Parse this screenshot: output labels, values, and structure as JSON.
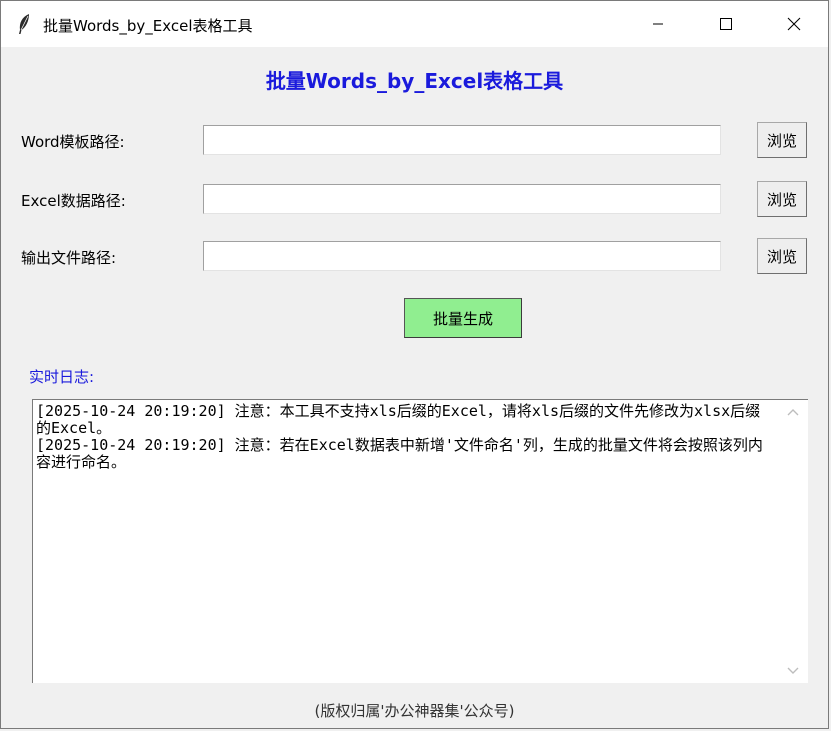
{
  "window": {
    "title": "批量Words_by_Excel表格工具",
    "minimize_glyph": "—",
    "maximize_glyph": "☐",
    "close_glyph": "✕"
  },
  "app": {
    "heading": "批量Words_by_Excel表格工具"
  },
  "form": {
    "fields": [
      {
        "label": "Word模板路径:",
        "value": "",
        "browse_label": "浏览"
      },
      {
        "label": "Excel数据路径:",
        "value": "",
        "browse_label": "浏览"
      },
      {
        "label": "输出文件路径:",
        "value": "",
        "browse_label": "浏览"
      }
    ],
    "generate_label": "批量生成"
  },
  "log": {
    "label": "实时日志:",
    "lines": [
      "[2025-10-24 20:19:20] 注意：本工具不支持xls后缀的Excel，请将xls后缀的文件先修改为xlsx后缀的Excel。",
      "[2025-10-24 20:19:20] 注意：若在Excel数据表中新增'文件命名'列，生成的批量文件将会按照该列内容进行命名。"
    ]
  },
  "footer": {
    "text": "(版权归属'办公神器集'公众号)"
  },
  "colors": {
    "accent": "#1a1adc",
    "generate_button": "#90ee90",
    "background": "#f0f0f0"
  }
}
